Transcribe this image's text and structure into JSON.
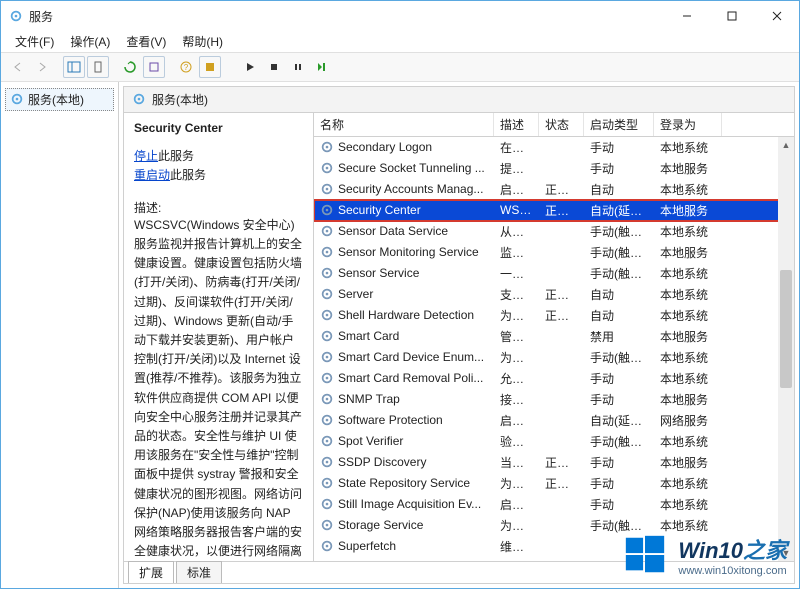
{
  "window": {
    "title": "服务"
  },
  "menus": {
    "file": "文件(F)",
    "action": "操作(A)",
    "view": "查看(V)",
    "help": "帮助(H)"
  },
  "left_tree": {
    "root": "服务(本地)"
  },
  "right_header": {
    "title": "服务(本地)"
  },
  "detail": {
    "title": "Security Center",
    "stop": "停止",
    "stop_suffix": "此服务",
    "restart": "重启动",
    "restart_suffix": "此服务",
    "desc_label": "描述:",
    "desc": "WSCSVC(Windows 安全中心)服务监视并报告计算机上的安全健康设置。健康设置包括防火墙(打开/关闭)、防病毒(打开/关闭/过期)、反间谍软件(打开/关闭/过期)、Windows 更新(自动/手动下载并安装更新)、用户帐户控制(打开/关闭)以及 Internet 设置(推荐/不推荐)。该服务为独立软件供应商提供 COM API 以便向安全中心服务注册并记录其产品的状态。安全性与维护 UI 使用该服务在\"安全性与维护\"控制面板中提供 systray 警报和安全健康状况的图形视图。网络访问保护(NAP)使用该服务向 NAP 网络策略服务器报告客户端的安全健康状况，以便进行网络隔离决策。该服务还提供一个公共"
  },
  "columns": {
    "name": "名称",
    "desc": "描述",
    "status": "状态",
    "startup": "启动类型",
    "logon": "登录为"
  },
  "services": [
    {
      "name": "Secondary Logon",
      "desc": "在不...",
      "status": "",
      "startup": "手动",
      "logon": "本地系统"
    },
    {
      "name": "Secure Socket Tunneling ...",
      "desc": "提供...",
      "status": "",
      "startup": "手动",
      "logon": "本地服务"
    },
    {
      "name": "Security Accounts Manag...",
      "desc": "启动...",
      "status": "正在...",
      "startup": "自动",
      "logon": "本地系统"
    },
    {
      "name": "Security Center",
      "desc": "WSC...",
      "status": "正在...",
      "startup": "自动(延迟...",
      "logon": "本地服务",
      "selected": true
    },
    {
      "name": "Sensor Data Service",
      "desc": "从各...",
      "status": "",
      "startup": "手动(触发...",
      "logon": "本地系统"
    },
    {
      "name": "Sensor Monitoring Service",
      "desc": "监视...",
      "status": "",
      "startup": "手动(触发...",
      "logon": "本地服务"
    },
    {
      "name": "Sensor Service",
      "desc": "一项...",
      "status": "",
      "startup": "手动(触发...",
      "logon": "本地系统"
    },
    {
      "name": "Server",
      "desc": "支持...",
      "status": "正在...",
      "startup": "自动",
      "logon": "本地系统"
    },
    {
      "name": "Shell Hardware Detection",
      "desc": "为自...",
      "status": "正在...",
      "startup": "自动",
      "logon": "本地系统"
    },
    {
      "name": "Smart Card",
      "desc": "管理...",
      "status": "",
      "startup": "禁用",
      "logon": "本地服务"
    },
    {
      "name": "Smart Card Device Enum...",
      "desc": "为给...",
      "status": "",
      "startup": "手动(触发...",
      "logon": "本地系统"
    },
    {
      "name": "Smart Card Removal Poli...",
      "desc": "允许...",
      "status": "",
      "startup": "手动",
      "logon": "本地系统"
    },
    {
      "name": "SNMP Trap",
      "desc": "接收...",
      "status": "",
      "startup": "手动",
      "logon": "本地服务"
    },
    {
      "name": "Software Protection",
      "desc": "启用...",
      "status": "",
      "startup": "自动(延迟...",
      "logon": "网络服务"
    },
    {
      "name": "Spot Verifier",
      "desc": "验证...",
      "status": "",
      "startup": "手动(触发...",
      "logon": "本地系统"
    },
    {
      "name": "SSDP Discovery",
      "desc": "当发...",
      "status": "正在...",
      "startup": "手动",
      "logon": "本地服务"
    },
    {
      "name": "State Repository Service",
      "desc": "为应...",
      "status": "正在...",
      "startup": "手动",
      "logon": "本地系统"
    },
    {
      "name": "Still Image Acquisition Ev...",
      "desc": "启动...",
      "status": "",
      "startup": "手动",
      "logon": "本地系统"
    },
    {
      "name": "Storage Service",
      "desc": "为存...",
      "status": "",
      "startup": "手动(触发...",
      "logon": "本地系统"
    },
    {
      "name": "Superfetch",
      "desc": "维护...",
      "status": "",
      "startup": "",
      "logon": ""
    }
  ],
  "tabs": {
    "extended": "扩展",
    "standard": "标准"
  },
  "watermark": {
    "brand": "Win10",
    "suffix": "之家",
    "url": "www.win10xitong.com"
  }
}
